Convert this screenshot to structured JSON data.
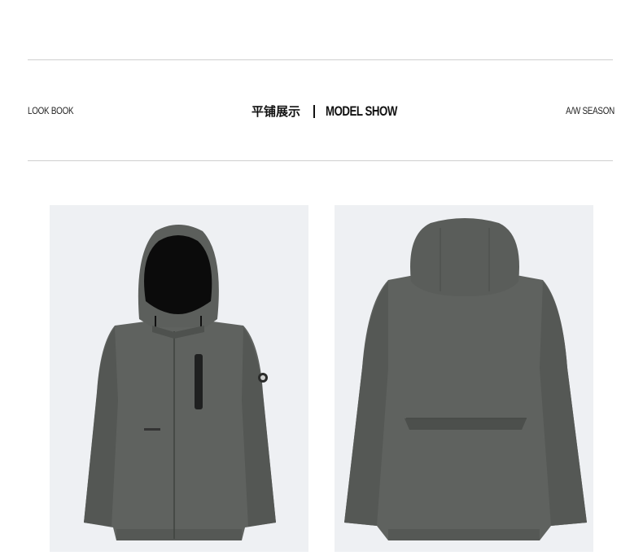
{
  "header": {
    "look_book": "LOOK BOOK",
    "title_cn": "平铺展示",
    "title_en": "MODEL SHOW",
    "season": "A/W SEASON"
  },
  "colors": {
    "jacket": "#5f625f",
    "jacket_shadow": "#4a4d4a",
    "panel_bg": "#eef0f3",
    "rule": "#cfcfcf"
  },
  "images": [
    {
      "name": "jacket-front-image",
      "alt": "hooded jacket front view"
    },
    {
      "name": "jacket-back-image",
      "alt": "hooded jacket back view"
    }
  ]
}
